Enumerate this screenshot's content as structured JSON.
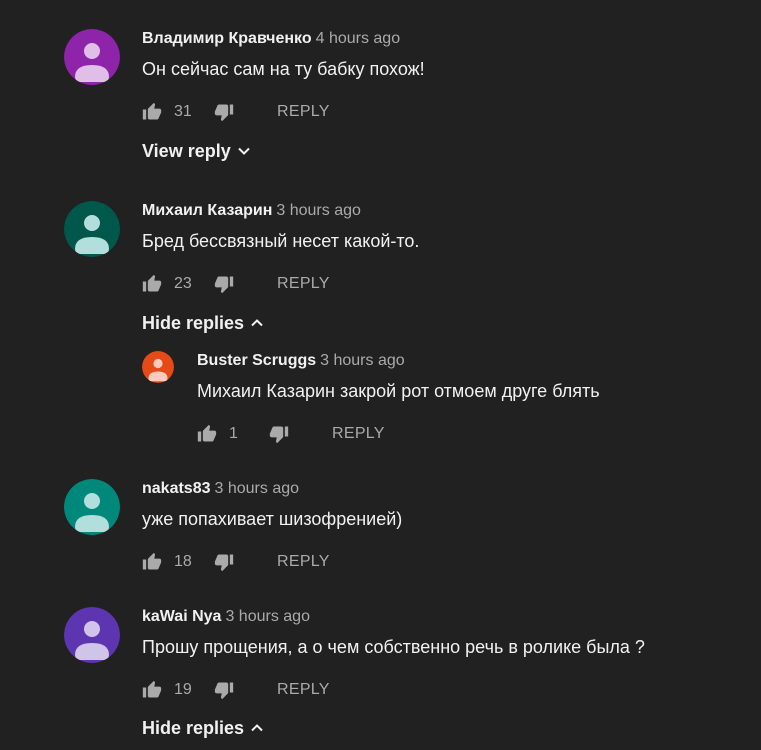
{
  "comments": [
    {
      "author": "Владимир Кравченко",
      "time": "4 hours ago",
      "text": "Он сейчас сам на ту бабку похож!",
      "likes": "31",
      "reply_label": "REPLY",
      "toggle_label": "View reply",
      "avatar_color": "#8e24aa"
    },
    {
      "author": "Михаил Казарин",
      "time": "3 hours ago",
      "text": "Бред бессвязный несет какой-то.",
      "likes": "23",
      "reply_label": "REPLY",
      "toggle_label": "Hide replies",
      "avatar_color": "#00574b",
      "replies": [
        {
          "author": "Buster Scruggs",
          "time": "3 hours ago",
          "text": "Михаил Казарин закрой рот отмоем друге блять",
          "likes": "1",
          "reply_label": "REPLY",
          "avatar_color": "#e64a19"
        }
      ]
    },
    {
      "author": "nakats83",
      "time": "3 hours ago",
      "text": "уже попахивает шизофренией)",
      "likes": "18",
      "reply_label": "REPLY",
      "avatar_color": "#00897b"
    },
    {
      "author": "kaWai Nya",
      "time": "3 hours ago",
      "text": "Прошу прощения, а о чем собственно речь в ролике была ?",
      "likes": "19",
      "reply_label": "REPLY",
      "toggle_label": "Hide replies",
      "avatar_color": "#5e35b1"
    }
  ]
}
